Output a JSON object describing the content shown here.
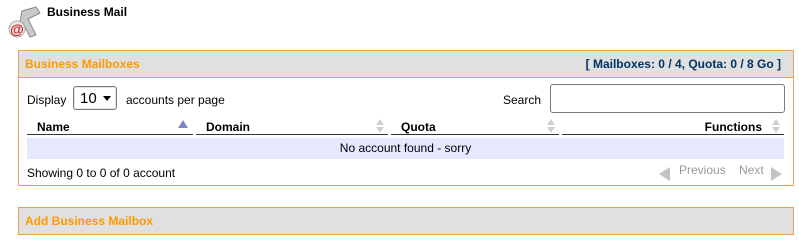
{
  "header": {
    "title": "Business Mail",
    "icon": "at-mail-icon"
  },
  "mailboxes_panel": {
    "title": "Business Mailboxes",
    "stats": "[ Mailboxes: 0 / 4, Quota: 0 / 8 Go ]"
  },
  "length_menu": {
    "label": "Display",
    "value": "10",
    "suffix": "accounts per page"
  },
  "search": {
    "label": "Search",
    "value": ""
  },
  "table": {
    "columns": [
      "Name",
      "Domain",
      "Quota",
      "Functions"
    ],
    "sorted_column": "Name",
    "empty_message": "No account found - sorry"
  },
  "info": "Showing 0 to 0 of 0 account",
  "pager": {
    "previous": "Previous",
    "next": "Next"
  },
  "add_panel": {
    "title": "Add Business Mailbox"
  },
  "colors": {
    "accent": "#ff9900",
    "panel_border": "#f0a050",
    "panel_header_bg": "#e0e0e0",
    "stats_text": "#003366",
    "empty_row_bg": "#e6e8ff"
  }
}
